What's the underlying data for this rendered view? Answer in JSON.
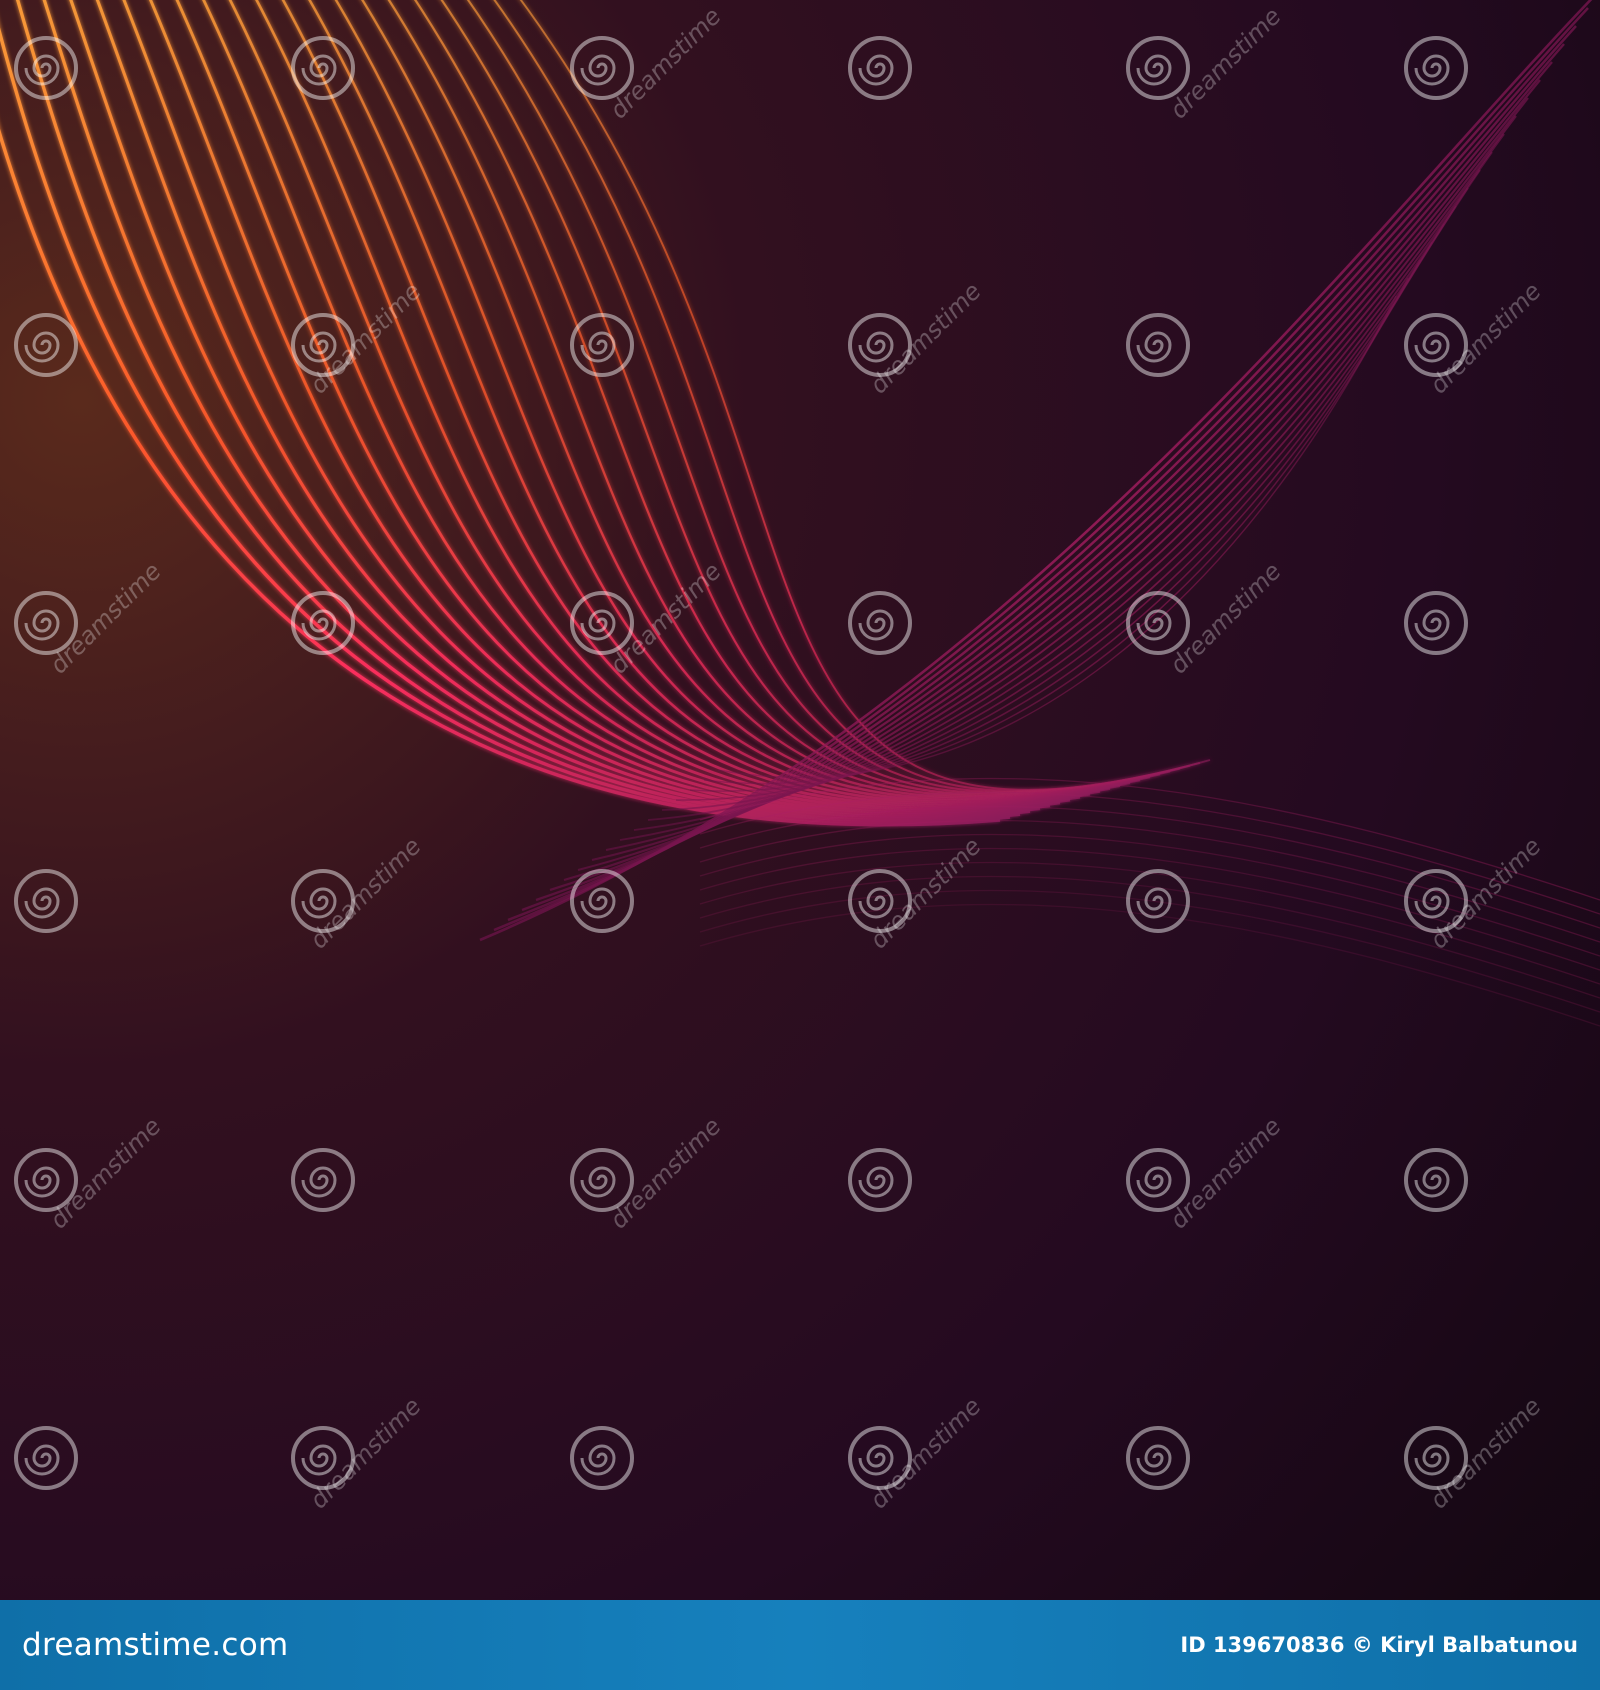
{
  "image": {
    "description_colors": {
      "background_top_left": "#4a1f1c",
      "background_center": "#2a0b25",
      "background_bottom_right": "#120812",
      "ribbon_orange": "#ff8a2a",
      "ribbon_red": "#ff3a3a",
      "ribbon_magenta": "#c2186a",
      "ribbon_purple": "#6e1550",
      "footer_bar": "#1680bd"
    },
    "watermark": {
      "text": "dreamstime",
      "icon": "spiral-logo-icon"
    }
  },
  "footer": {
    "brand": "dreamstime.com",
    "id_label": "ID 139670836",
    "copyright_symbol": "©",
    "author": "Kiryl Balbatunou"
  }
}
